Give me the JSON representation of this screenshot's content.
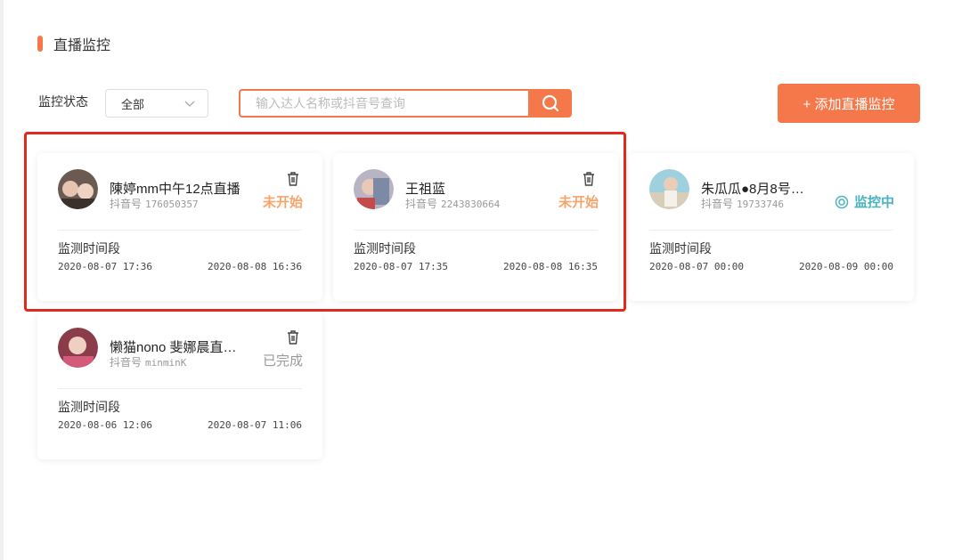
{
  "section": {
    "title": "直播监控"
  },
  "filter": {
    "label": "监控状态",
    "status_value": "全部",
    "search_placeholder": "输入达人名称或抖音号查询",
    "add_button": "+ 添加直播监控"
  },
  "colors": {
    "accent": "#f5784a",
    "pending": "#f7a46a",
    "active": "#4ab3c1",
    "highlight": "#e3281c"
  },
  "cards": [
    {
      "name": "陳婷mm中午12点直播",
      "uid_label": "抖音号",
      "uid": "176050357",
      "status": "未开始",
      "period_label": "监测时间段",
      "start": "2020-08-07 17:36",
      "end": "2020-08-08 16:36"
    },
    {
      "name": "王祖蓝",
      "uid_label": "抖音号",
      "uid": "2243830664",
      "status": "未开始",
      "period_label": "监测时间段",
      "start": "2020-08-07 17:35",
      "end": "2020-08-08 16:35"
    },
    {
      "name": "朱瓜瓜●8月8号…",
      "uid_label": "抖音号",
      "uid": "19733746",
      "status": "监控中",
      "period_label": "监测时间段",
      "start": "2020-08-07 00:00",
      "end": "2020-08-09 00:00"
    },
    {
      "name": "懒猫nono 斐娜晨直…",
      "uid_label": "抖音号",
      "uid": "minminK",
      "status": "已完成",
      "period_label": "监测时间段",
      "start": "2020-08-06 12:06",
      "end": "2020-08-07 11:06"
    }
  ]
}
